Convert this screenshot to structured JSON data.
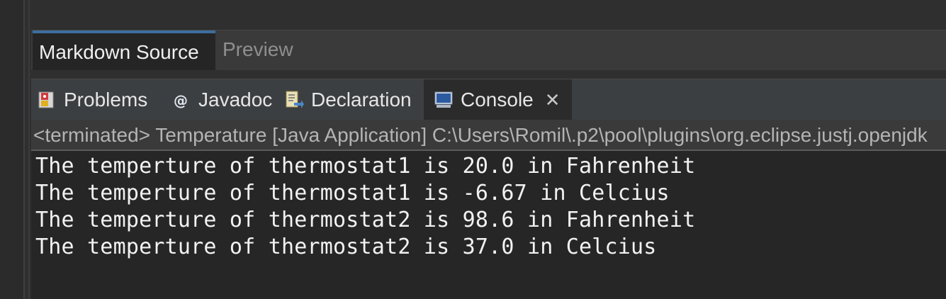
{
  "markdown_editor": {
    "tabs": [
      {
        "label": "Markdown Source",
        "active": true
      },
      {
        "label": "Preview",
        "active": false
      }
    ]
  },
  "views": {
    "tabs": [
      {
        "label": "Problems",
        "icon": "problems-icon",
        "active": false
      },
      {
        "label": "Javadoc",
        "icon": "javadoc-at-icon",
        "active": false
      },
      {
        "label": "Declaration",
        "icon": "declaration-icon",
        "active": false
      },
      {
        "label": "Console",
        "icon": "console-monitor-icon",
        "active": true
      }
    ],
    "close_glyph": "✕"
  },
  "console": {
    "header": "<terminated> Temperature [Java Application] C:\\Users\\Romil\\.p2\\pool\\plugins\\org.eclipse.justj.openjdk",
    "lines": [
      "The temperture of thermostat1 is 20.0 in Fahrenheit",
      "The temperture of thermostat1 is -6.67 in Celcius",
      "The temperture of thermostat2 is 98.6 in Fahrenheit",
      "The temperture of thermostat2 is 37.0 in Celcius"
    ]
  },
  "colors": {
    "active_tab_accent": "#3d6e9e",
    "console_bg": "#262626",
    "text": "#f2f2f2"
  }
}
